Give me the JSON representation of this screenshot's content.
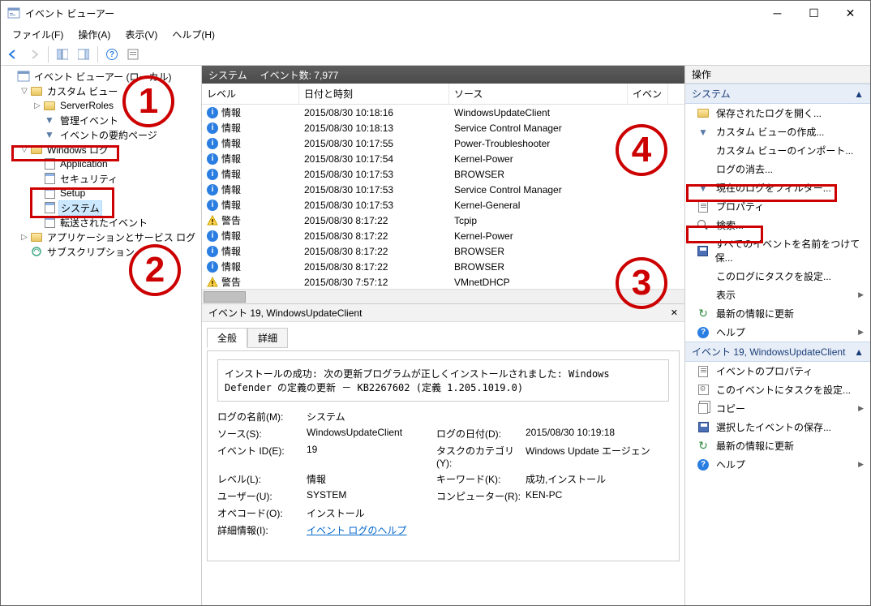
{
  "window": {
    "title": "イベント ビューアー"
  },
  "menu": {
    "file": "ファイル(F)",
    "action": "操作(A)",
    "view": "表示(V)",
    "help": "ヘルプ(H)"
  },
  "tree": {
    "root": "イベント ビューアー (ローカル)",
    "custom": "カスタム ビュー",
    "serverRoles": "ServerRoles",
    "adminEvents": "管理イベント",
    "summaryPage": "イベントの要約ページ",
    "winLogs": "Windows ログ",
    "app": "Application",
    "security": "セキュリティ",
    "setup": "Setup",
    "system": "システム",
    "forwarded": "転送されたイベント",
    "appsServices": "アプリケーションとサービス ログ",
    "subscriptions": "サブスクリプション"
  },
  "centerHdr": {
    "name": "システム",
    "count": "イベント数: 7,977"
  },
  "cols": {
    "level": "レベル",
    "date": "日付と時刻",
    "source": "ソース",
    "event": "イベン"
  },
  "levels": {
    "info": "情報",
    "warn": "警告"
  },
  "rows": [
    {
      "lvl": "info",
      "dt": "2015/08/30 10:18:16",
      "src": "WindowsUpdateClient"
    },
    {
      "lvl": "info",
      "dt": "2015/08/30 10:18:13",
      "src": "Service Control Manager"
    },
    {
      "lvl": "info",
      "dt": "2015/08/30 10:17:55",
      "src": "Power-Troubleshooter"
    },
    {
      "lvl": "info",
      "dt": "2015/08/30 10:17:54",
      "src": "Kernel-Power"
    },
    {
      "lvl": "info",
      "dt": "2015/08/30 10:17:53",
      "src": "BROWSER"
    },
    {
      "lvl": "info",
      "dt": "2015/08/30 10:17:53",
      "src": "Service Control Manager"
    },
    {
      "lvl": "info",
      "dt": "2015/08/30 10:17:53",
      "src": "Kernel-General"
    },
    {
      "lvl": "warn",
      "dt": "2015/08/30 8:17:22",
      "src": "Tcpip"
    },
    {
      "lvl": "info",
      "dt": "2015/08/30 8:17:22",
      "src": "Kernel-Power"
    },
    {
      "lvl": "info",
      "dt": "2015/08/30 8:17:22",
      "src": "BROWSER"
    },
    {
      "lvl": "info",
      "dt": "2015/08/30 8:17:22",
      "src": "BROWSER"
    },
    {
      "lvl": "warn",
      "dt": "2015/08/30 7:57:12",
      "src": "VMnetDHCP"
    }
  ],
  "detail": {
    "hdr": "イベント 19, WindowsUpdateClient",
    "tabGeneral": "全般",
    "tabDetails": "詳細",
    "msg": "インストールの成功: 次の更新プログラムが正しくインストールされました: Windows Defender の定義の更新 － KB2267602 (定義 1.205.1019.0)",
    "k_logname": "ログの名前(M):",
    "v_logname": "システム",
    "k_source": "ソース(S):",
    "v_source": "WindowsUpdateClient",
    "k_logdate": "ログの日付(D):",
    "v_logdate": "2015/08/30 10:19:18",
    "k_eventid": "イベント ID(E):",
    "v_eventid": "19",
    "k_taskcat": "タスクのカテゴリ(Y):",
    "v_taskcat": "Windows Update エージェン",
    "k_level": "レベル(L):",
    "v_level": "情報",
    "k_keywords": "キーワード(K):",
    "v_keywords": "成功,インストール",
    "k_user": "ユーザー(U):",
    "v_user": "SYSTEM",
    "k_computer": "コンピューター(R):",
    "v_computer": "KEN-PC",
    "k_opcode": "オペコード(O):",
    "v_opcode": "インストール",
    "k_moreinfo": "詳細情報(I):",
    "v_moreinfo": "イベント ログのヘルプ"
  },
  "actions": {
    "hdr": "操作",
    "sec1": "システム",
    "openSaved": "保存されたログを開く...",
    "createCustom": "カスタム ビューの作成...",
    "importCustom": "カスタム ビューのインポート...",
    "clearLog": "ログの消去...",
    "filterLog": "現在のログをフィルター...",
    "properties": "プロパティ",
    "find": "検索...",
    "saveAll": "すべてのイベントを名前をつけて保...",
    "attachTask": "このログにタスクを設定...",
    "view": "表示",
    "refresh": "最新の情報に更新",
    "help": "ヘルプ",
    "sec2": "イベント 19, WindowsUpdateClient",
    "eventProps": "イベントのプロパティ",
    "attachTaskEvent": "このイベントにタスクを設定...",
    "copy": "コピー",
    "saveSelected": "選択したイベントの保存...",
    "refresh2": "最新の情報に更新",
    "help2": "ヘルプ"
  },
  "callouts": {
    "1": "1",
    "2": "2",
    "3": "3",
    "4": "4"
  }
}
